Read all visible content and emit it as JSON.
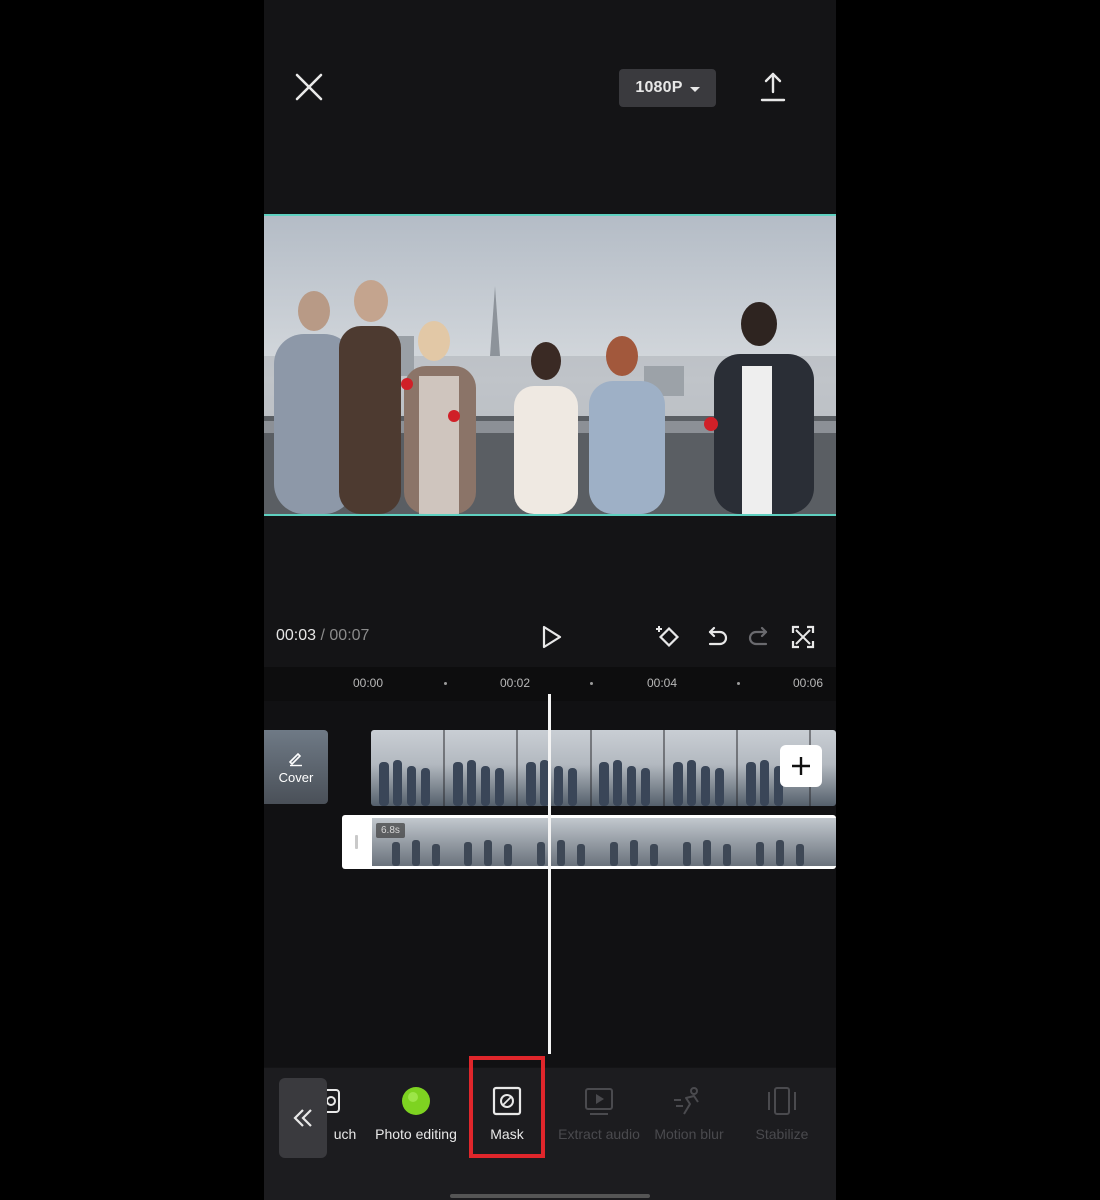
{
  "topbar": {
    "resolution_label": "1080P"
  },
  "player": {
    "current_time": "00:03",
    "separator": "/",
    "total_time": "00:07"
  },
  "timeline": {
    "ruler_labels": [
      "00:00",
      "00:02",
      "00:04",
      "00:06"
    ],
    "cover_label": "Cover",
    "clip_duration": "6.8s"
  },
  "toolbar": {
    "tools": [
      {
        "label": "uch",
        "icon": "touch-icon",
        "state": "normal"
      },
      {
        "label": "Photo editing",
        "icon": "photo-editing-icon",
        "state": "normal"
      },
      {
        "label": "Mask",
        "icon": "mask-icon",
        "state": "highlighted"
      },
      {
        "label": "Extract audio",
        "icon": "extract-audio-icon",
        "state": "disabled"
      },
      {
        "label": "Motion blur",
        "icon": "motion-blur-icon",
        "state": "disabled"
      },
      {
        "label": "Stabilize",
        "icon": "stabilize-icon",
        "state": "disabled"
      }
    ]
  },
  "colors": {
    "accent_teal": "#5fd0c0",
    "highlight_red": "#e0262b",
    "photo_editing_green": "#7ed321"
  }
}
